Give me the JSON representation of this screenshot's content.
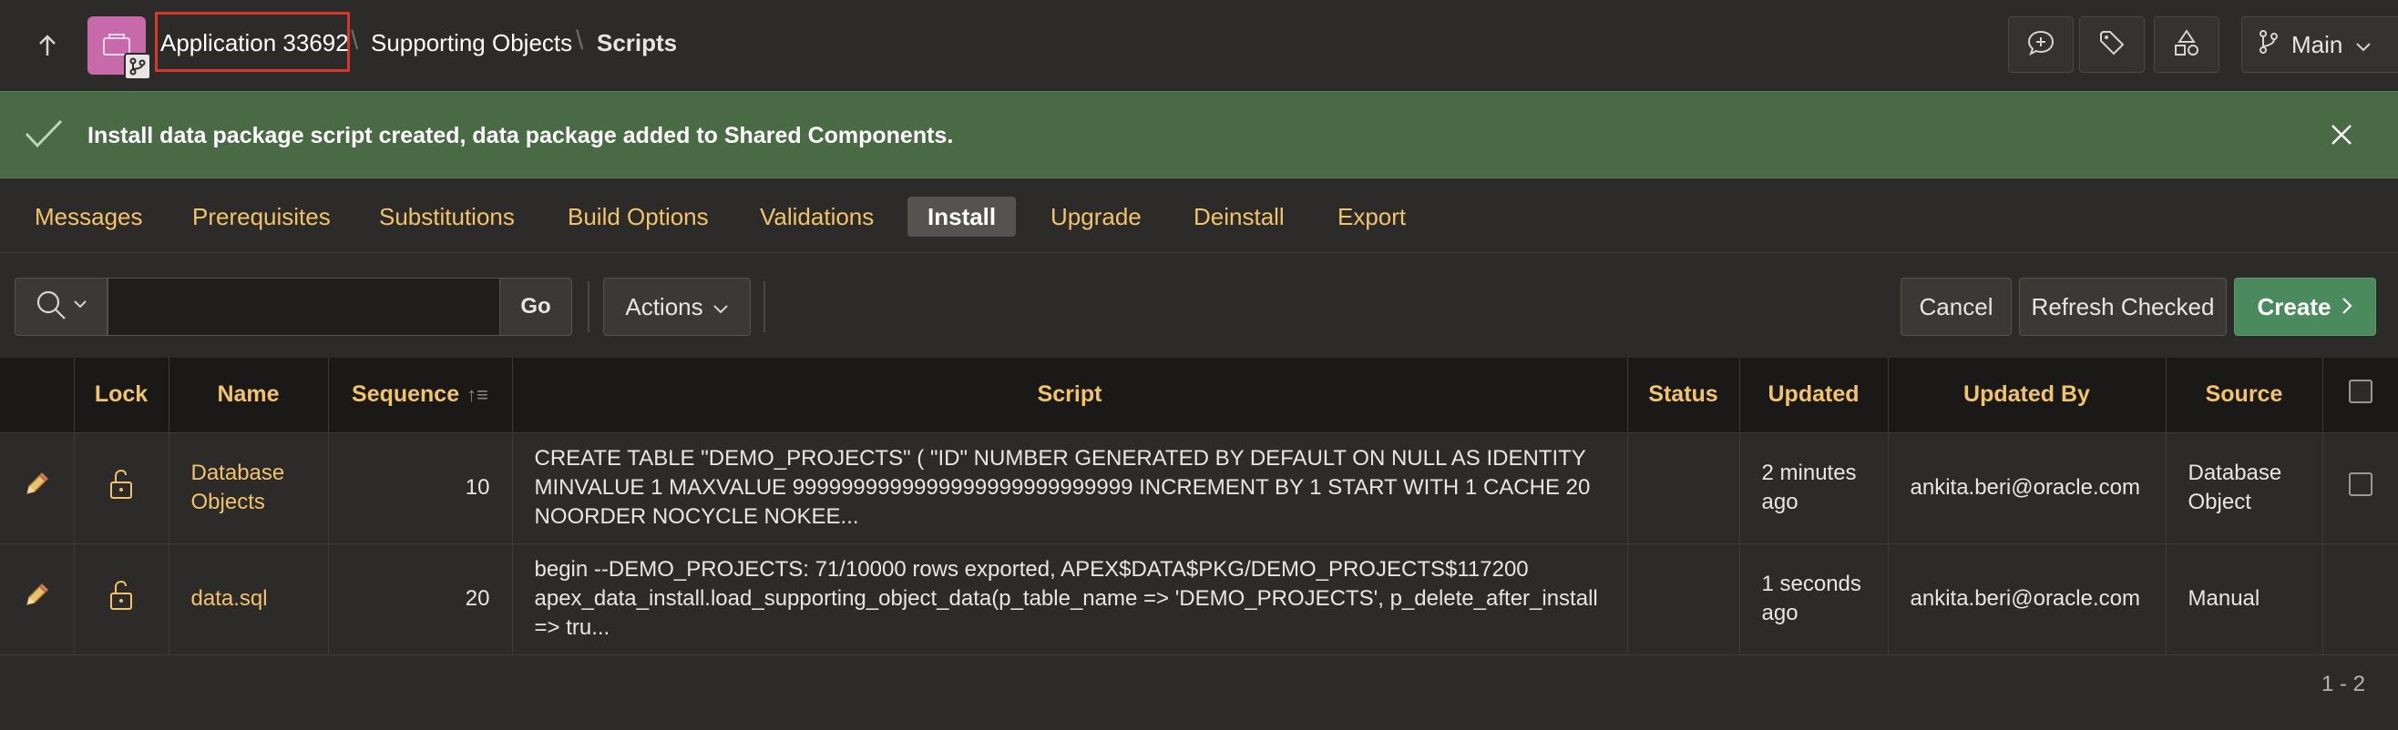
{
  "header": {
    "breadcrumbs": [
      "Application 33692",
      "Supporting Objects",
      "Scripts"
    ],
    "branch_label": "Main",
    "icons": [
      "up-arrow-icon",
      "app-icon",
      "branch-badge-icon",
      "add-comment-icon",
      "tag-icon",
      "shapes-icon",
      "branch-icon",
      "chevron-down-icon"
    ]
  },
  "banner": {
    "message": "Install data package script created, data package added to Shared Components.",
    "accent": "#4a6a45"
  },
  "tabs": [
    {
      "label": "Messages",
      "active": false
    },
    {
      "label": "Prerequisites",
      "active": false
    },
    {
      "label": "Substitutions",
      "active": false
    },
    {
      "label": "Build Options",
      "active": false
    },
    {
      "label": "Validations",
      "active": false
    },
    {
      "label": "Install",
      "active": true
    },
    {
      "label": "Upgrade",
      "active": false
    },
    {
      "label": "Deinstall",
      "active": false
    },
    {
      "label": "Export",
      "active": false
    }
  ],
  "toolbar": {
    "search_value": "",
    "go_label": "Go",
    "actions_label": "Actions",
    "cancel_label": "Cancel",
    "refresh_label": "Refresh Checked",
    "create_label": "Create"
  },
  "table": {
    "columns": [
      "",
      "Lock",
      "Name",
      "Sequence",
      "Script",
      "Status",
      "Updated",
      "Updated By",
      "Source",
      ""
    ],
    "rows": [
      {
        "name": "Database Objects",
        "sequence": "10",
        "script": "CREATE TABLE \"DEMO_PROJECTS\" ( \"ID\" NUMBER GENERATED BY DEFAULT ON NULL AS IDENTITY MINVALUE 1 MAXVALUE 9999999999999999999999999999 INCREMENT BY 1 START WITH 1 CACHE 20 NOORDER NOCYCLE NOKEE...",
        "status": "",
        "updated": "2 minutes ago",
        "updated_by": "ankita.beri@oracle.com",
        "source": "Database Object"
      },
      {
        "name": "data.sql",
        "sequence": "20",
        "script": "begin --DEMO_PROJECTS: 71/10000 rows exported, APEX$DATA$PKG/DEMO_PROJECTS$117200 apex_data_install.load_supporting_object_data(p_table_name => 'DEMO_PROJECTS', p_delete_after_install => tru...",
        "status": "",
        "updated": "1 seconds ago",
        "updated_by": "ankita.beri@oracle.com",
        "source": "Manual"
      }
    ],
    "pagination": "1 - 2"
  }
}
